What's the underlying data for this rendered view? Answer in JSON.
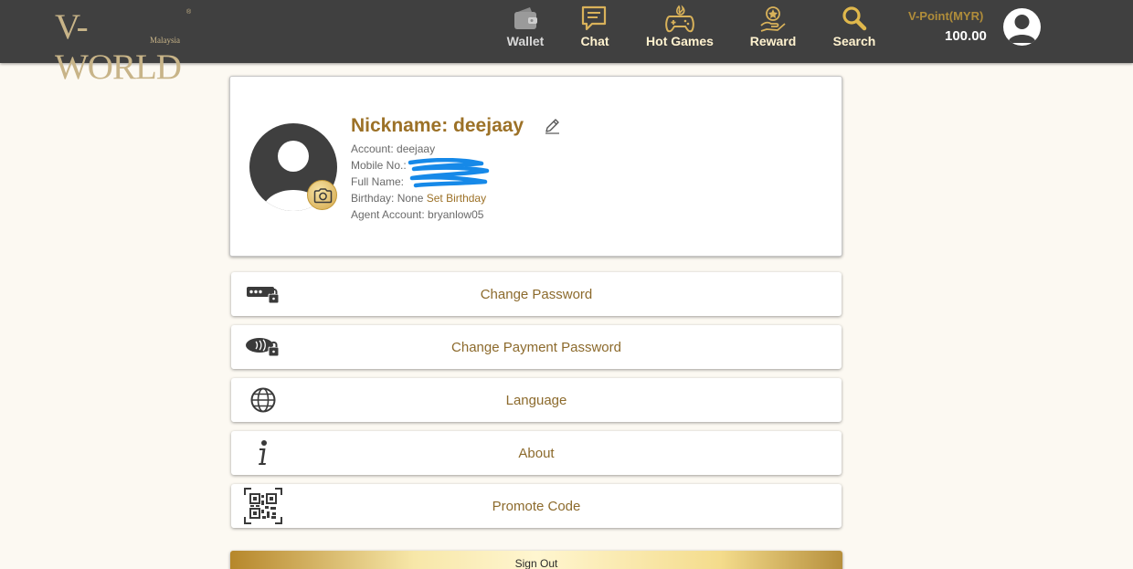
{
  "header": {
    "logo_text": "V-WORLD",
    "logo_subtext": "Malaysia",
    "logo_reg": "®",
    "nav": [
      {
        "label": "Wallet",
        "icon": "wallet-icon"
      },
      {
        "label": "Chat",
        "icon": "chat-icon"
      },
      {
        "label": "Hot Games",
        "icon": "gamepad-icon"
      },
      {
        "label": "Reward",
        "icon": "reward-icon"
      },
      {
        "label": "Search",
        "icon": "search-icon"
      }
    ],
    "vpoint_label": "V-Point(MYR)",
    "vpoint_value": "100.00"
  },
  "profile": {
    "nickname": "Nickname: deejaay",
    "account": "Account: deejaay",
    "mobile_label": "Mobile No.:",
    "fullname_label": "Full Name:",
    "birthday": "Birthday: None",
    "set_birthday": "Set Birthday",
    "agent": "Agent Account: bryanlow05"
  },
  "menu": [
    {
      "label": "Change Password",
      "icon": "password-lock-icon"
    },
    {
      "label": "Change Payment Password",
      "icon": "payment-lock-icon"
    },
    {
      "label": "Language",
      "icon": "globe-icon"
    },
    {
      "label": "About",
      "icon": "info-icon"
    },
    {
      "label": "Promote Code",
      "icon": "qr-code-icon"
    }
  ],
  "signout_label": "Sign Out",
  "colors": {
    "header_bg": "#404040",
    "gold_text": "#9c7127",
    "menu_text": "#8c6a2c",
    "page_bg": "#fcf9f2"
  }
}
